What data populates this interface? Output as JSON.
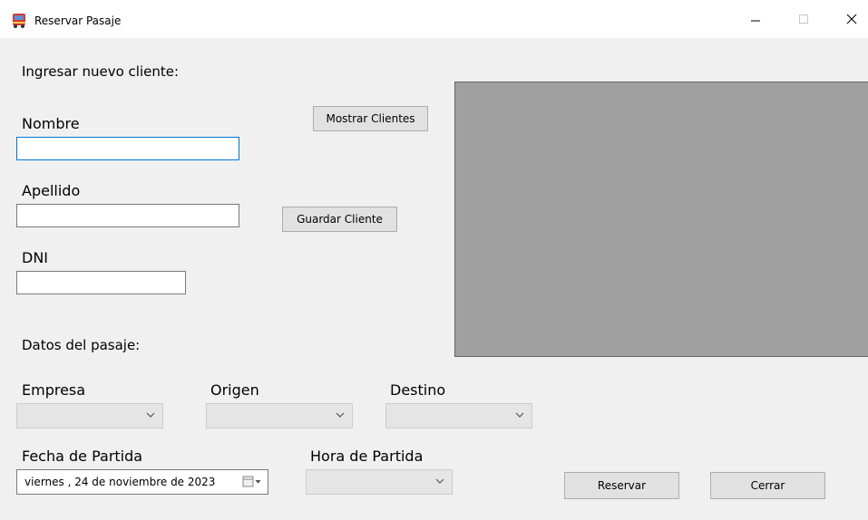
{
  "window": {
    "title": "Reservar Pasaje",
    "app_icon": "bus-icon",
    "controls": [
      "minimize-icon",
      "maximize-icon",
      "close-icon"
    ]
  },
  "cliente": {
    "section_title": "Ingresar nuevo cliente:",
    "nombre_label": "Nombre",
    "nombre_value": "",
    "apellido_label": "Apellido",
    "apellido_value": "",
    "dni_label": "DNI",
    "dni_value": "",
    "mostrar_button": "Mostrar Clientes",
    "guardar_button": "Guardar Cliente"
  },
  "pasaje": {
    "section_title": "Datos del pasaje:",
    "empresa_label": "Empresa",
    "empresa_value": "",
    "origen_label": "Origen",
    "origen_value": "",
    "destino_label": "Destino",
    "destino_value": "",
    "fecha_label": "Fecha de Partida",
    "fecha_value": "viernes  , 24 de noviembre de 2023",
    "hora_label": "Hora de Partida",
    "hora_value": ""
  },
  "actions": {
    "reservar_button": "Reservar",
    "cerrar_button": "Cerrar"
  },
  "colors": {
    "window_bg": "#f0f0f0",
    "titlebar_bg": "#ffffff",
    "grid_bg": "#a0a0a0",
    "focus_border": "#0078d7",
    "button_bg": "#e1e1e1"
  }
}
